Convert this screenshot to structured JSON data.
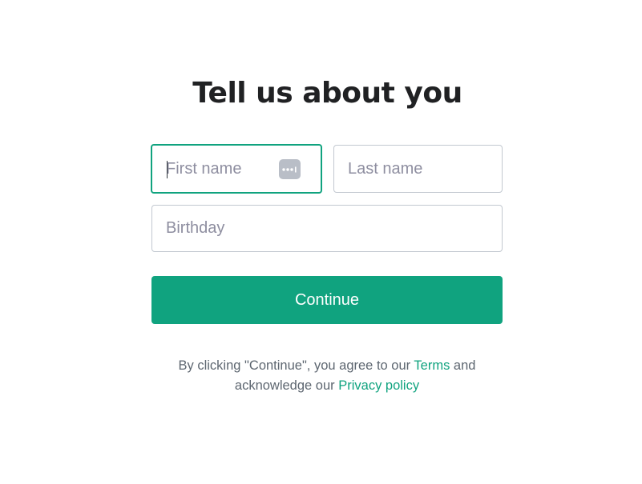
{
  "title": "Tell us about you",
  "fields": {
    "first_name": {
      "value": "",
      "placeholder": "First name"
    },
    "last_name": {
      "value": "",
      "placeholder": "Last name"
    },
    "birthday": {
      "value": "",
      "placeholder": "Birthday"
    }
  },
  "password_manager_icon": "password-dots-icon",
  "continue_label": "Continue",
  "legal": {
    "prefix": "By clicking \"Continue\", you agree to our ",
    "terms_link": "Terms",
    "middle": " and acknowledge our ",
    "privacy_link": "Privacy policy"
  },
  "colors": {
    "accent": "#10a37f",
    "title": "#202123",
    "placeholder": "#8e8ea0",
    "border": "#c2c8d0",
    "body_text": "#5d6670"
  }
}
